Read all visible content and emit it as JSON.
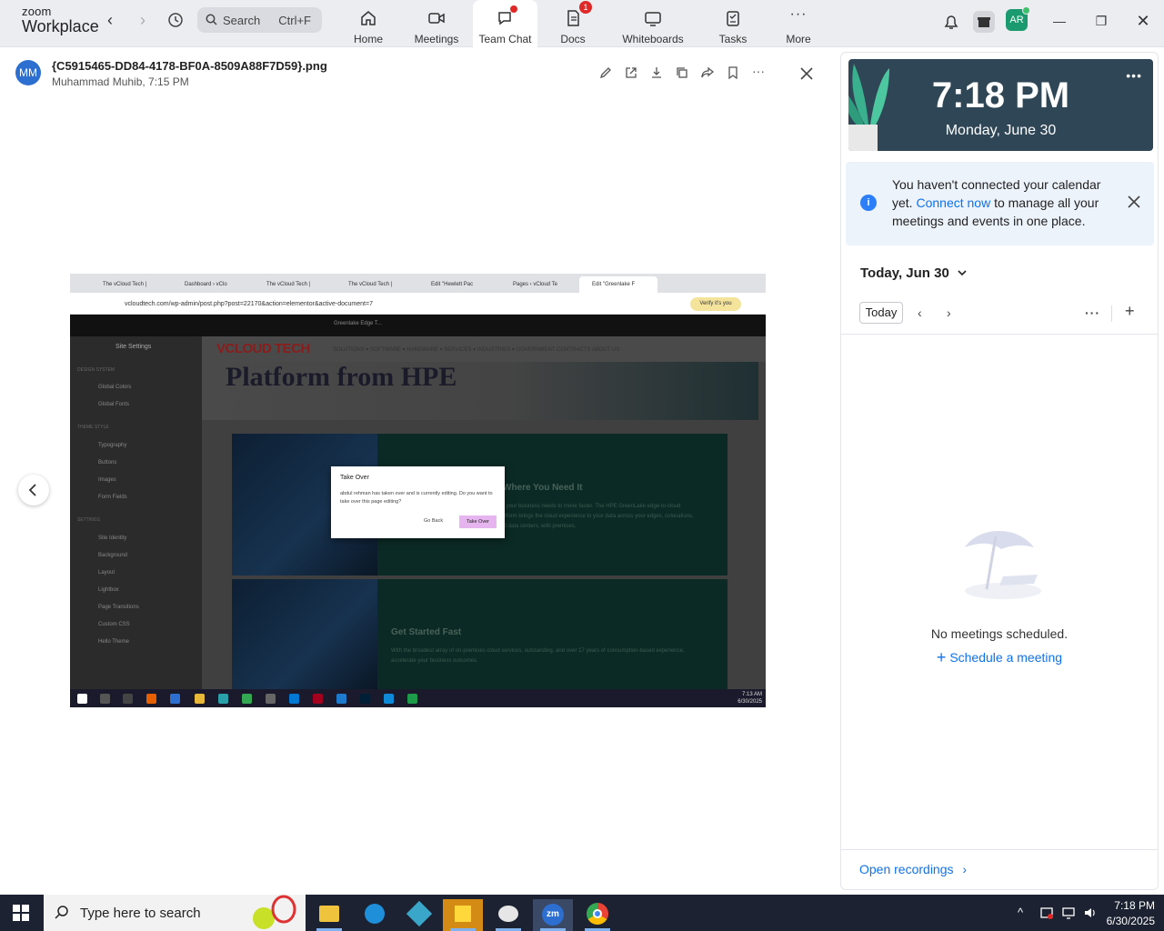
{
  "app": {
    "brand_small": "zoom",
    "brand_large": "Workplace"
  },
  "search": {
    "placeholder": "Search",
    "shortcut": "Ctrl+F"
  },
  "nav": {
    "home": "Home",
    "meetings": "Meetings",
    "team_chat": "Team Chat",
    "docs": "Docs",
    "docs_badge": "1",
    "whiteboards": "Whiteboards",
    "tasks": "Tasks",
    "more": "More"
  },
  "user": {
    "initials": "AR"
  },
  "viewer": {
    "sender_initials": "MM",
    "filename": "{C5915465-DD84-4178-BF0A-8509A88F7D59}.png",
    "meta": "Muhammad Muhib, 7:15 PM"
  },
  "screenshot": {
    "tabs": [
      "The vCloud Tech |",
      "Dashboard › vClo",
      "The vCloud Tech |",
      "The vCloud Tech |",
      "Edit \"Hewlett Pac",
      "Pages ‹ vCloud Te",
      "Edit \"Greenlake F"
    ],
    "url": "vcloudtech.com/wp-admin/post.php?post=22170&action=elementor&active-document=7",
    "verify": "Verify it's you",
    "wp_center": "Greenlake Edge T...",
    "sidebar_title": "Site Settings",
    "sidebar_items": [
      "Global Colors",
      "Global Fonts",
      "Typography",
      "Buttons",
      "Images",
      "Form Fields",
      "Site Identity",
      "Background",
      "Layout",
      "Lightbox",
      "Page Transitions",
      "Custom CSS",
      "Hello Theme"
    ],
    "sidebar_groups": [
      "DESIGN SYSTEM",
      "THEME STYLE",
      "SETTINGS"
    ],
    "brand": "VCLOUD TECH",
    "menu": "SOLUTIONS ▾   SOFTWARE ▾   HARDWARE ▾   SERVICES ▾   INDUSTRIES ▾   GOVERNMENT CONTRACTS   ABOUT US",
    "hero": "Platform from HPE",
    "card1_title": "Where You Need It",
    "card1_text": "ing your business needs to move faster. The HPE GreenLake edge-to-cloud platform brings the cloud experience to your data across your edges, colocations, and data centers, with premises.",
    "card2_title": "Get Started Fast",
    "card2_text": "With the broadest array of on-premises cloud services, outstanding, and over 17 years of consumption-based experience, accelerate your business outcomes.",
    "dialog_title": "Take Over",
    "dialog_msg": "abdul rehman has taken over and is currently editing. Do you want to take over this page editing?",
    "dialog_back": "Go Back",
    "dialog_take": "Take Over",
    "time": "7:13 AM",
    "date": "6/30/2025"
  },
  "panel": {
    "time": "7:18 PM",
    "date": "Monday, June 30",
    "notice_pre": "You haven't connected your calendar yet.",
    "notice_link": "Connect now",
    "notice_post": "to manage all your meetings and events in one place.",
    "day_label": "Today, Jun 30",
    "today_btn": "Today",
    "empty_text": "No meetings scheduled.",
    "schedule_link": "Schedule a meeting",
    "open_recordings": "Open recordings"
  },
  "taskbar": {
    "search_placeholder": "Type here to search",
    "time": "7:18 PM",
    "date": "6/30/2025"
  }
}
